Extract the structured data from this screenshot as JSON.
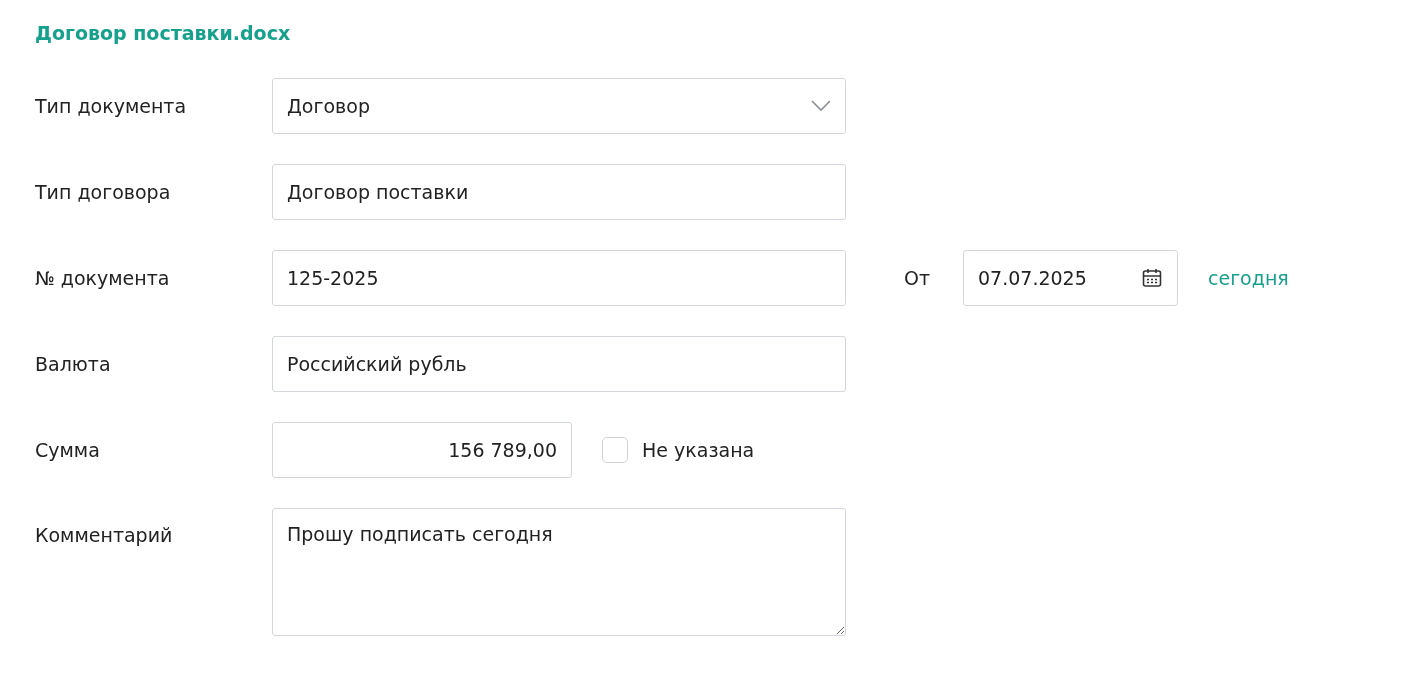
{
  "title": "Договор поставки.docx",
  "fields": [
    {
      "kind": "select",
      "label": "Тип документа",
      "value": "Договор"
    },
    {
      "kind": "text",
      "label": "Тип договора",
      "value": "Договор поставки"
    },
    {
      "kind": "dated",
      "label": "№ документа",
      "value": "125-2025",
      "date_label": "От",
      "date_value": "07.07.2025",
      "today_link": "сегодня"
    },
    {
      "kind": "text",
      "label": "Валюта",
      "value": "Российский рубль"
    },
    {
      "kind": "amount",
      "label": "Сумма",
      "value": "156 789,00",
      "checkbox_label": "Не указана",
      "checked": false
    },
    {
      "kind": "textarea",
      "label": "Комментарий",
      "value": "Прошу подписать сегодня"
    }
  ]
}
